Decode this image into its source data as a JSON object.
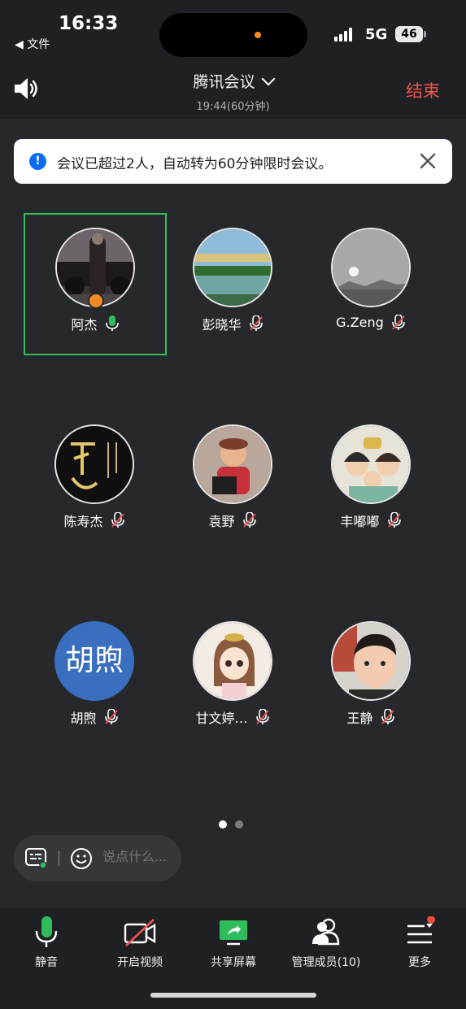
{
  "status_bar": {
    "time": "16:33",
    "back_app": "◀ 文件",
    "network": "5G",
    "battery": "46"
  },
  "header": {
    "title": "腾讯会议",
    "subtitle": "19:44(60分钟)",
    "end_label": "结束"
  },
  "banner": {
    "text": "会议已超过2人，自动转为60分钟限时会议。"
  },
  "participants": [
    {
      "name": "阿杰",
      "mic": "on",
      "host": true,
      "active": true
    },
    {
      "name": "彭晓华",
      "mic": "muted"
    },
    {
      "name": "G.Zeng",
      "mic": "muted"
    },
    {
      "name": "陈寿杰",
      "mic": "muted"
    },
    {
      "name": "袁野",
      "mic": "muted"
    },
    {
      "name": "丰嘟嘟",
      "mic": "muted"
    },
    {
      "name": "胡煦",
      "mic": "muted",
      "initials": "胡煦"
    },
    {
      "name": "甘文婷…",
      "mic": "muted"
    },
    {
      "name": "王静",
      "mic": "muted"
    }
  ],
  "pager": {
    "pages": 2,
    "current": 1
  },
  "chat": {
    "placeholder": "说点什么..."
  },
  "toolbar": {
    "mute": "静音",
    "video": "开启视频",
    "share": "共享屏幕",
    "members": "管理成员(10)",
    "more": "更多"
  },
  "colors": {
    "accent_green": "#2fbd5c",
    "end_red": "#f0544e",
    "info_blue": "#0a6cf5",
    "notify_red": "#f04a3c"
  }
}
